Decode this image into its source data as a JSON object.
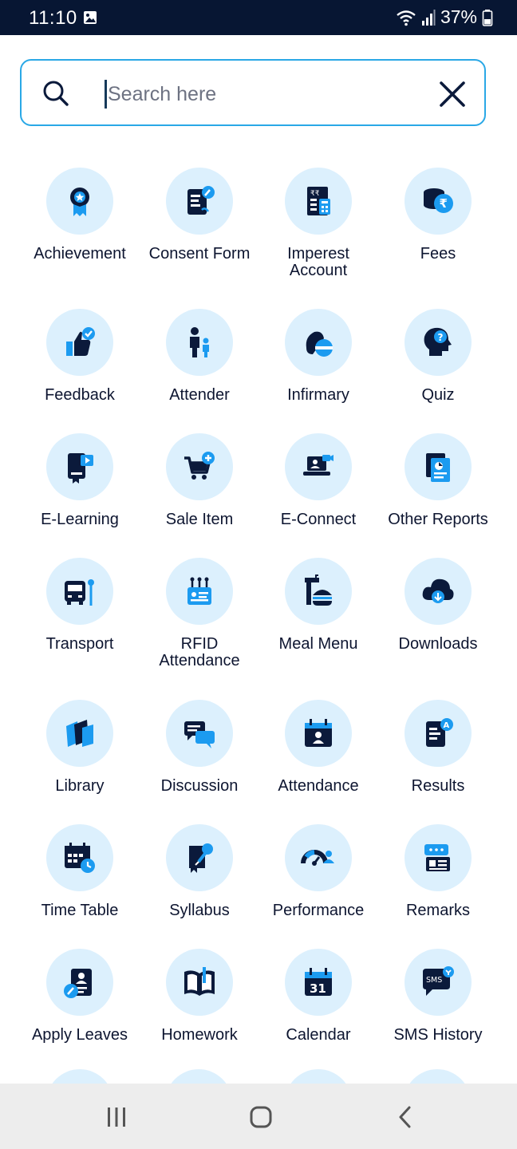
{
  "status": {
    "time": "11:10",
    "battery": "37%",
    "icons": [
      "image-icon",
      "wifi-icon",
      "signal-icon",
      "battery-icon"
    ]
  },
  "search": {
    "placeholder": "Search here",
    "value": ""
  },
  "colors": {
    "accent": "#2aa8e6",
    "icon_dark": "#0b1a3b",
    "icon_blue": "#1c9bf0",
    "circle_bg": "#dcf0fd",
    "status_bar": "#071633"
  },
  "modules": [
    {
      "label": "Achievement",
      "icon": "award-icon"
    },
    {
      "label": "Consent Form",
      "icon": "consent-form-icon"
    },
    {
      "label": "Imperest\nAccount",
      "icon": "imperest-account-icon"
    },
    {
      "label": "Fees",
      "icon": "fees-coins-icon"
    },
    {
      "label": "Feedback",
      "icon": "thumbs-up-icon"
    },
    {
      "label": "Attender",
      "icon": "adult-child-icon"
    },
    {
      "label": "Infirmary",
      "icon": "pills-icon"
    },
    {
      "label": "Quiz",
      "icon": "head-question-icon"
    },
    {
      "label": "E-Learning",
      "icon": "elearning-icon"
    },
    {
      "label": "Sale Item",
      "icon": "cart-add-icon"
    },
    {
      "label": "E-Connect",
      "icon": "laptop-video-icon"
    },
    {
      "label": "Other Reports",
      "icon": "report-icon"
    },
    {
      "label": "Transport",
      "icon": "bus-stop-icon"
    },
    {
      "label": "RFID\nAttendance",
      "icon": "rfid-card-icon"
    },
    {
      "label": "Meal Menu",
      "icon": "meal-icon"
    },
    {
      "label": "Downloads",
      "icon": "cloud-download-icon"
    },
    {
      "label": "Library",
      "icon": "books-icon"
    },
    {
      "label": "Discussion",
      "icon": "chat-bubbles-icon"
    },
    {
      "label": "Attendance",
      "icon": "calendar-person-icon"
    },
    {
      "label": "Results",
      "icon": "results-icon"
    },
    {
      "label": "Time Table",
      "icon": "calendar-clock-icon"
    },
    {
      "label": "Syllabus",
      "icon": "syllabus-icon"
    },
    {
      "label": "Performance",
      "icon": "gauge-people-icon"
    },
    {
      "label": "Remarks",
      "icon": "remarks-icon"
    },
    {
      "label": "Apply Leaves",
      "icon": "leave-form-icon"
    },
    {
      "label": "Homework",
      "icon": "open-book-icon"
    },
    {
      "label": "Calendar",
      "icon": "calendar-31-icon"
    },
    {
      "label": "SMS History",
      "icon": "sms-icon"
    }
  ],
  "nav": [
    "recent-apps-icon",
    "home-icon",
    "back-icon"
  ]
}
